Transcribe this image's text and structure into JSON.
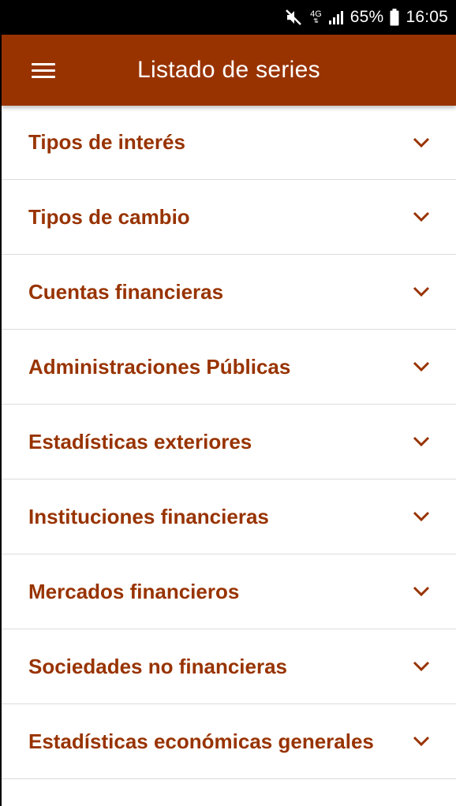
{
  "status_bar": {
    "network": "4G",
    "battery": "65%",
    "time": "16:05"
  },
  "app_bar": {
    "title": "Listado de series"
  },
  "colors": {
    "primary": "#983300",
    "status_bar": "#000000",
    "background": "#ffffff",
    "divider": "#dcdcdc"
  },
  "list": {
    "items": [
      {
        "label": "Tipos de interés",
        "icon": "chevron-down-icon"
      },
      {
        "label": "Tipos de cambio",
        "icon": "chevron-down-icon"
      },
      {
        "label": "Cuentas financieras",
        "icon": "chevron-down-icon"
      },
      {
        "label": "Administraciones Públicas",
        "icon": "chevron-down-icon"
      },
      {
        "label": "Estadísticas exteriores",
        "icon": "chevron-down-icon"
      },
      {
        "label": "Instituciones financieras",
        "icon": "chevron-down-icon"
      },
      {
        "label": "Mercados financieros",
        "icon": "chevron-down-icon"
      },
      {
        "label": "Sociedades no financieras",
        "icon": "chevron-down-icon"
      },
      {
        "label": "Estadísticas económicas generales",
        "icon": "chevron-down-icon"
      }
    ]
  }
}
